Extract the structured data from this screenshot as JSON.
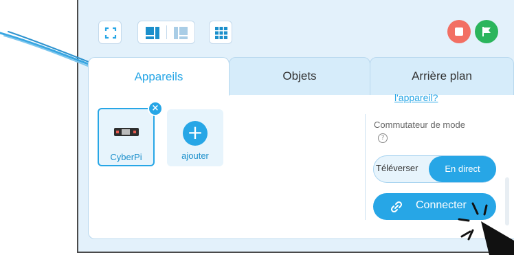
{
  "tabs": {
    "appareils": "Appareils",
    "objets": "Objets",
    "arriere_plan": "Arrière plan"
  },
  "devices": {
    "cyberpi_label": "CyberPi",
    "close_glyph": "×",
    "add_label": "ajouter",
    "add_glyph": "+"
  },
  "right_panel": {
    "help_link": "l'appareil?",
    "mode_label": "Commutateur de mode",
    "help_glyph": "?",
    "toggle_off": "Téléverser",
    "toggle_on": "En direct",
    "connect_label": "Connecter"
  },
  "colors": {
    "accent": "#27a6e6",
    "stop": "#f26f63",
    "go": "#2bb55c",
    "frame_bg": "#e3f1fb"
  },
  "icons": [
    "fullscreen-icon",
    "layout-left-icon",
    "layout-right-icon",
    "grid-icon",
    "stop-icon",
    "flag-icon",
    "link-icon",
    "help-icon",
    "close-icon",
    "plus-icon",
    "arrow-annotation",
    "hand-cursor-icon"
  ]
}
